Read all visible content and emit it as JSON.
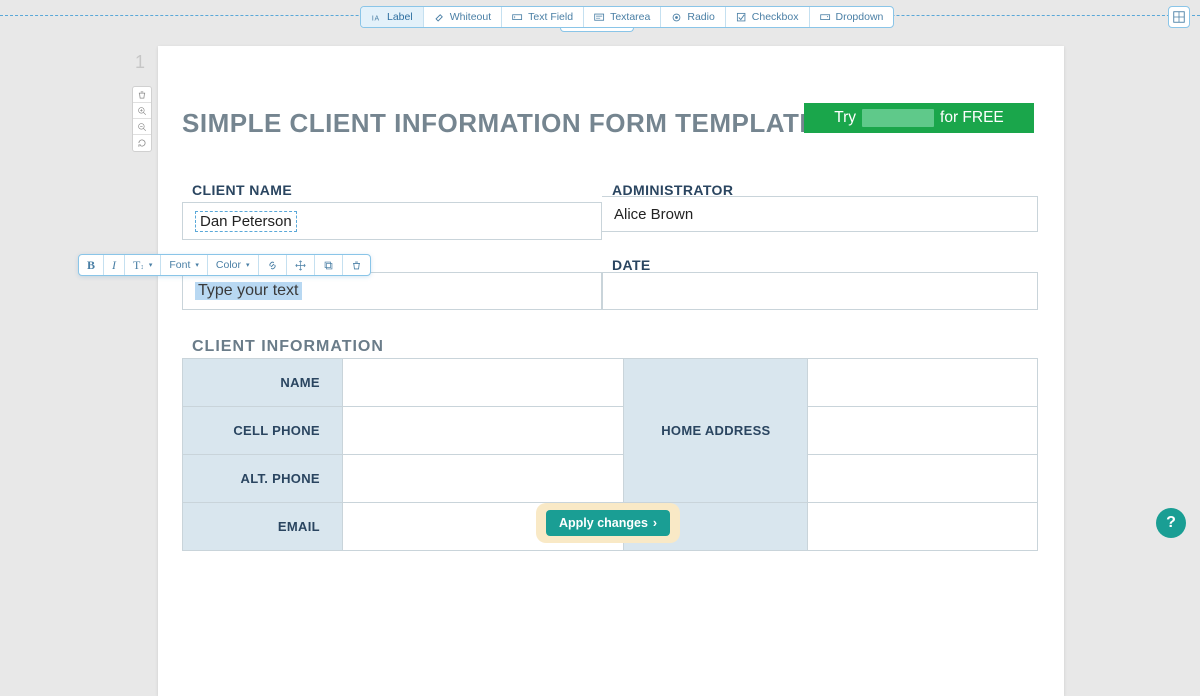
{
  "toolbar": {
    "items": [
      {
        "label": "Label",
        "icon": "label"
      },
      {
        "label": "Whiteout",
        "icon": "eraser"
      },
      {
        "label": "Text Field",
        "icon": "textfield"
      },
      {
        "label": "Textarea",
        "icon": "textarea"
      },
      {
        "label": "Radio",
        "icon": "radio"
      },
      {
        "label": "Checkbox",
        "icon": "checkbox"
      },
      {
        "label": "Dropdown",
        "icon": "dropdown"
      }
    ]
  },
  "page_number": "1",
  "doc": {
    "title": "SIMPLE CLIENT INFORMATION FORM TEMPLATE",
    "try_prefix": "Try",
    "try_suffix": "for FREE",
    "fields": {
      "client_name_label": "CLIENT NAME",
      "client_name_value": "Dan Peterson",
      "administrator_label": "ADMINISTRATOR",
      "administrator_value": "Alice Brown",
      "date_label": "DATE",
      "date_value": "",
      "typing_placeholder": "Type your text"
    },
    "section_title": "CLIENT INFORMATION",
    "info_rows": [
      "NAME",
      "CELL PHONE",
      "ALT. PHONE",
      "EMAIL"
    ],
    "home_address_label": "HOME ADDRESS"
  },
  "text_toolbar": {
    "bold": "B",
    "italic": "I",
    "size": "T",
    "font": "Font",
    "color": "Color"
  },
  "apply_label": "Apply changes",
  "help": "?"
}
